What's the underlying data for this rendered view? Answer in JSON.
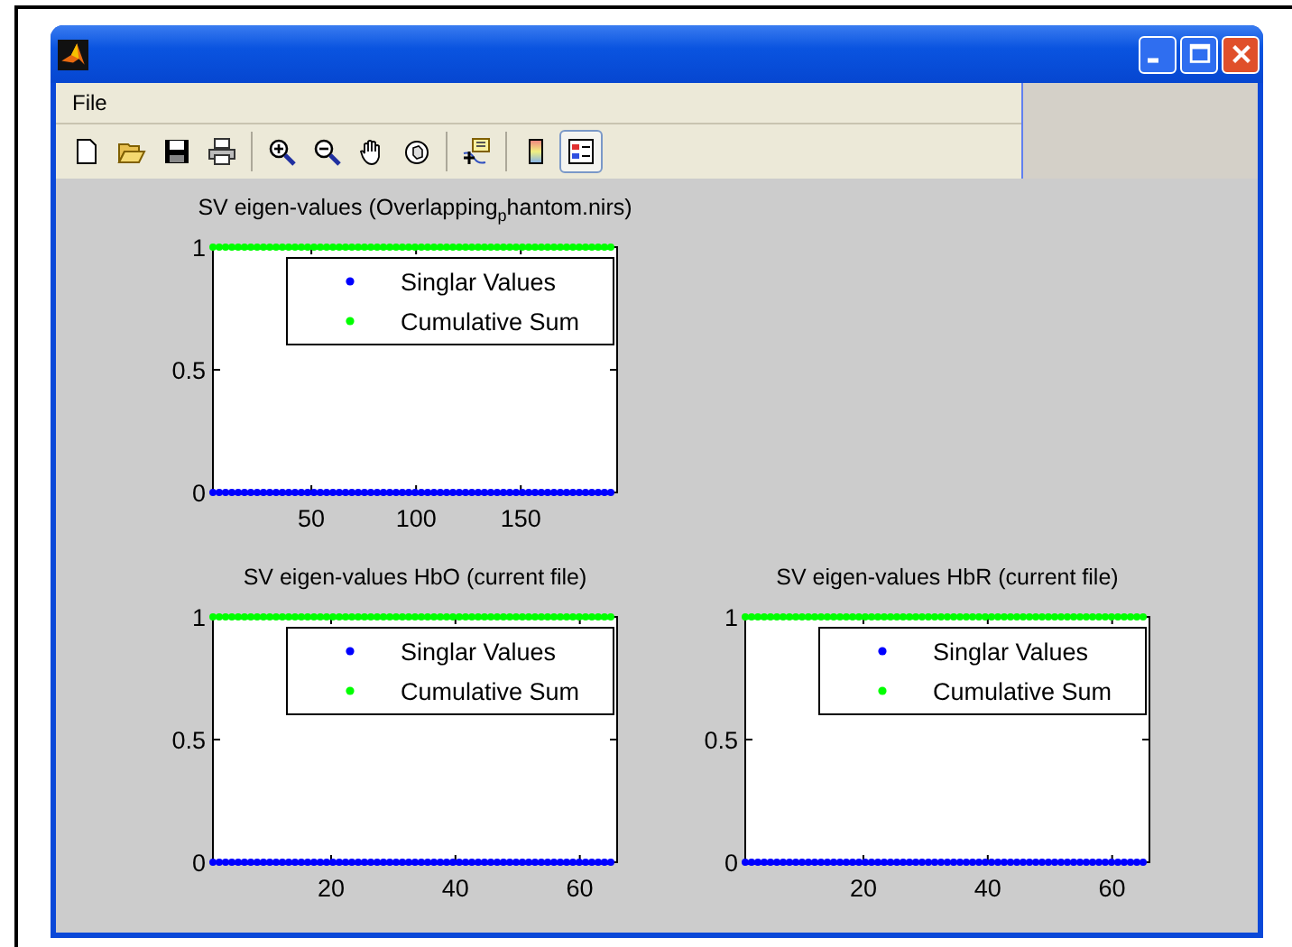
{
  "window": {
    "menu": [
      "File"
    ]
  },
  "toolbar": {
    "groups": [
      {
        "tools": [
          {
            "kind": "new",
            "selected": false
          },
          {
            "kind": "open",
            "selected": false
          },
          {
            "kind": "save",
            "selected": false
          },
          {
            "kind": "print",
            "selected": false
          }
        ]
      },
      {
        "tools": [
          {
            "kind": "zoom-in",
            "selected": false
          },
          {
            "kind": "zoom-out",
            "selected": false
          },
          {
            "kind": "pan",
            "selected": false
          },
          {
            "kind": "rotate",
            "selected": false
          }
        ]
      },
      {
        "tools": [
          {
            "kind": "data-cursor",
            "selected": false
          }
        ]
      },
      {
        "tools": [
          {
            "kind": "colorbar",
            "selected": false
          },
          {
            "kind": "legend",
            "selected": true
          }
        ]
      }
    ]
  },
  "charts": [
    {
      "chart_data": {
        "type": "line",
        "title": "SV eigen-values (Overlapping$_{p}$hantom.nirs)",
        "x": [
          3,
          196
        ],
        "xlim": [
          3,
          196
        ],
        "ylim": [
          0,
          1
        ],
        "xticks": [
          50,
          100,
          150
        ],
        "yticks": [
          0,
          0.5,
          1
        ],
        "legend": true,
        "series": [
          {
            "name": "Singlar Values",
            "color": "#0000ff",
            "line_style": "dotted",
            "values": [
              0,
              0
            ]
          },
          {
            "name": "Cumulative Sum",
            "color": "#00ff00",
            "line_style": "dotted",
            "values": [
              1,
              1
            ]
          }
        ]
      }
    },
    {
      "chart_data": {
        "type": "line",
        "title": "SV eigen-values HbO (current file)",
        "x": [
          1,
          66
        ],
        "xlim": [
          1,
          66
        ],
        "ylim": [
          0,
          1
        ],
        "xticks": [
          20,
          40,
          60
        ],
        "yticks": [
          0,
          0.5,
          1
        ],
        "legend": true,
        "series": [
          {
            "name": "Singlar Values",
            "color": "#0000ff",
            "line_style": "dotted",
            "values": [
              0,
              0
            ]
          },
          {
            "name": "Cumulative Sum",
            "color": "#00ff00",
            "line_style": "dotted",
            "values": [
              1,
              1
            ]
          }
        ]
      }
    },
    {
      "chart_data": {
        "type": "line",
        "title": "SV eigen-values HbR (current file)",
        "x": [
          1,
          66
        ],
        "xlim": [
          1,
          66
        ],
        "ylim": [
          0,
          1
        ],
        "xticks": [
          20,
          40,
          60
        ],
        "yticks": [
          0,
          0.5,
          1
        ],
        "legend": true,
        "series": [
          {
            "name": "Singlar Values",
            "color": "#0000ff",
            "line_style": "dotted",
            "values": [
              0,
              0
            ]
          },
          {
            "name": "Cumulative Sum",
            "color": "#00ff00",
            "line_style": "dotted",
            "values": [
              1,
              1
            ]
          }
        ]
      }
    }
  ]
}
